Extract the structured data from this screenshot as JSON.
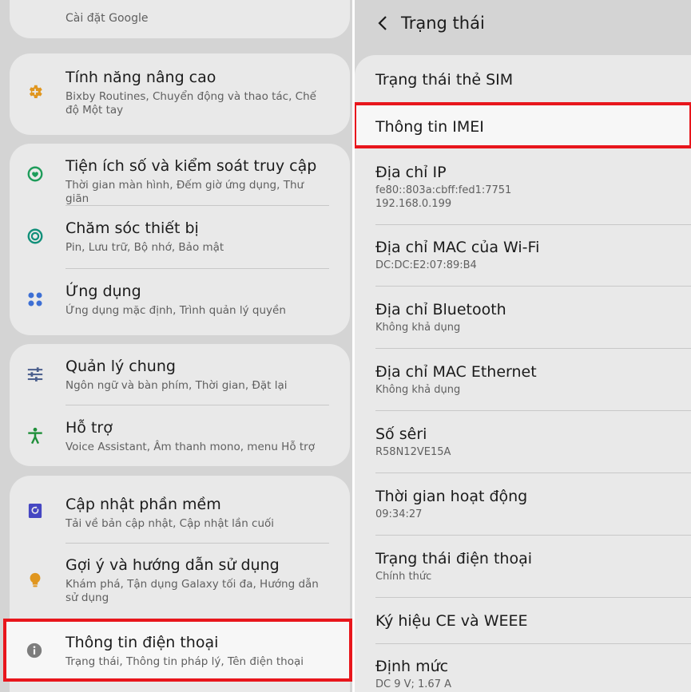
{
  "left": {
    "top_partial": "Cài đặt Google",
    "items": [
      {
        "title": "Tính năng nâng cao",
        "sub": "Bixby Routines, Chuyển động và thao tác, Chế độ Một tay",
        "icon": "gear-plus-icon",
        "color": "#e0961f"
      },
      {
        "title": "Tiện ích số và kiểm soát truy cập",
        "sub": "Thời gian màn hình, Đếm giờ ứng dụng, Thư giãn",
        "icon": "digital-wellbeing-icon",
        "color": "#1e9c5a"
      },
      {
        "title": "Chăm sóc thiết bị",
        "sub": "Pin, Lưu trữ, Bộ nhớ, Bảo mật",
        "icon": "device-care-icon",
        "color": "#12907a"
      },
      {
        "title": "Ứng dụng",
        "sub": "Ứng dụng mặc định, Trình quản lý quyền",
        "icon": "apps-icon",
        "color": "#3d6fd4"
      },
      {
        "title": "Quản lý chung",
        "sub": "Ngôn ngữ và bàn phím, Thời gian, Đặt lại",
        "icon": "sliders-icon",
        "color": "#4a5e8c"
      },
      {
        "title": "Hỗ trợ",
        "sub": "Voice Assistant, Âm thanh mono, menu Hỗ trợ",
        "icon": "accessibility-icon",
        "color": "#1f8f3a"
      },
      {
        "title": "Cập nhật phần mềm",
        "sub": "Tải về bản cập nhật, Cập nhật lần cuối",
        "icon": "software-update-icon",
        "color": "#4546c2"
      },
      {
        "title": "Gợi ý và hướng dẫn sử dụng",
        "sub": "Khám phá, Tận dụng Galaxy tối đa, Hướng dẫn sử dụng",
        "icon": "lightbulb-icon",
        "color": "#e0961f"
      },
      {
        "title": "Thông tin điện thoại",
        "sub": "Trạng thái, Thông tin pháp lý, Tên điện thoại",
        "icon": "info-icon",
        "color": "#7d7d7d"
      }
    ]
  },
  "right": {
    "header_title": "Trạng thái",
    "items": [
      {
        "title": "Trạng thái thẻ SIM",
        "sub": ""
      },
      {
        "title": "Thông tin IMEI",
        "sub": ""
      },
      {
        "title": "Địa chỉ IP",
        "sub": "fe80::803a:cbff:fed1:7751\n192.168.0.199"
      },
      {
        "title": "Địa chỉ MAC của Wi-Fi",
        "sub": "DC:DC:E2:07:89:B4"
      },
      {
        "title": "Địa chỉ Bluetooth",
        "sub": "Không khả dụng"
      },
      {
        "title": "Địa chỉ MAC Ethernet",
        "sub": "Không khả dụng"
      },
      {
        "title": "Số sêri",
        "sub": "R58N12VE15A"
      },
      {
        "title": "Thời gian hoạt động",
        "sub": "09:34:27"
      },
      {
        "title": "Trạng thái điện thoại",
        "sub": "Chính thức"
      },
      {
        "title": "Ký hiệu CE và WEEE",
        "sub": ""
      },
      {
        "title": "Định mức",
        "sub": "DC 9 V; 1.67 A"
      }
    ]
  },
  "colors": {
    "highlight": "#e8161c",
    "background": "#d4d4d4",
    "card": "#e9e9e9"
  }
}
